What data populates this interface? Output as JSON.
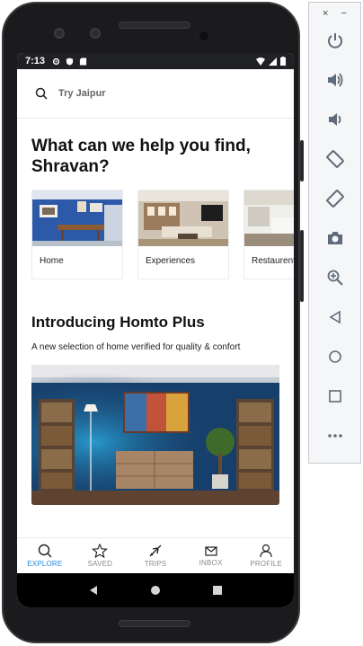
{
  "status_bar": {
    "time": "7:13"
  },
  "search": {
    "placeholder": "Try Jaipur"
  },
  "greeting": "What can we help you find, Shravan?",
  "categories": [
    {
      "label": "Home"
    },
    {
      "label": "Experiences"
    },
    {
      "label": "Restaurents"
    }
  ],
  "promo": {
    "title": "Introducing Homto Plus",
    "subtitle": "A new selection of home verified for quality & confort"
  },
  "bottom_nav": {
    "items": [
      {
        "label": "EXPLORE",
        "icon": "search-icon",
        "active": true
      },
      {
        "label": "SAVED",
        "icon": "star-icon",
        "active": false
      },
      {
        "label": "TRIPS",
        "icon": "plane-icon",
        "active": false
      },
      {
        "label": "INBOX",
        "icon": "mail-icon",
        "active": false
      },
      {
        "label": "PROFILE",
        "icon": "user-icon",
        "active": false
      }
    ]
  },
  "emulator_toolbar": {
    "window_controls": [
      "×",
      "−"
    ],
    "buttons": [
      "power-icon",
      "volume-up-icon",
      "volume-down-icon",
      "rotate-left-icon",
      "rotate-right-icon",
      "camera-icon",
      "zoom-icon",
      "back-icon",
      "home-icon",
      "overview-icon",
      "more-icon"
    ]
  },
  "colors": {
    "accent": "#1e88e5",
    "status_bar": "#202124",
    "toolbar_icon": "#5f6b7a"
  }
}
